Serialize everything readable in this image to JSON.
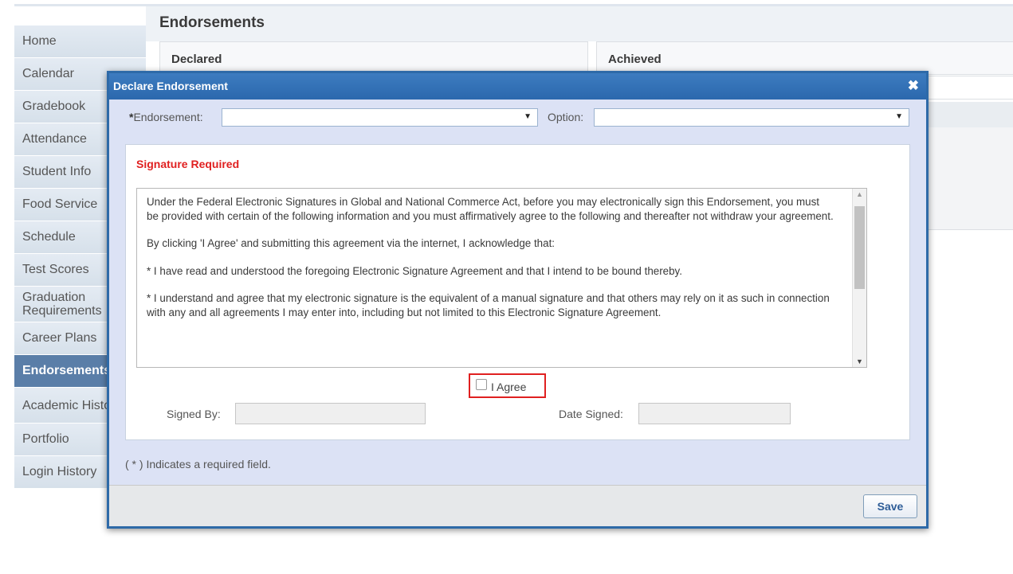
{
  "sidebar": {
    "items": [
      {
        "label": "Home"
      },
      {
        "label": "Calendar"
      },
      {
        "label": "Gradebook"
      },
      {
        "label": "Attendance"
      },
      {
        "label": "Student Info"
      },
      {
        "label": "Food Service"
      },
      {
        "label": "Schedule"
      },
      {
        "label": "Test Scores"
      },
      {
        "label": "Graduation Requirements"
      },
      {
        "label": "Career Plans"
      },
      {
        "label": "Endorsements"
      },
      {
        "label": "Academic History"
      },
      {
        "label": "Portfolio"
      },
      {
        "label": "Login History"
      }
    ],
    "active_index": 10
  },
  "main": {
    "title": "Endorsements",
    "declared_title": "Declared",
    "achieved_title": "Achieved"
  },
  "modal": {
    "title": "Declare Endorsement",
    "close_icon": "✖",
    "required_star": "*",
    "endorsement_label": "Endorsement:",
    "endorsement_value": "",
    "option_label": "Option:",
    "option_value": "",
    "signature_required": "Signature Required",
    "agreement_paragraphs": [
      "Under the Federal Electronic Signatures in Global and National Commerce Act, before you may electronically sign this Endorsement, you must be provided with certain of the following information and you must affirmatively agree to the following and thereafter not withdraw your agreement.",
      "By clicking 'I Agree' and submitting this agreement via the internet, I acknowledge that:",
      "* I have read and understood the foregoing Electronic Signature Agreement and that I intend to be bound thereby.",
      "* I understand and agree that my electronic signature is the equivalent of a manual signature and that others may rely on it as such in connection with any and all agreements I may enter into, including but not limited to this Electronic Signature Agreement."
    ],
    "agree_label": "I Agree",
    "agree_checked": false,
    "signed_by_label": "Signed By:",
    "signed_by_value": "",
    "date_signed_label": "Date Signed:",
    "date_signed_value": "",
    "required_note": "( * ) Indicates a required field.",
    "save_label": "Save"
  },
  "colors": {
    "titlebar": "#2e6aa8",
    "signature_required": "#e02020",
    "active_sidebar": "#5a7ea8"
  }
}
